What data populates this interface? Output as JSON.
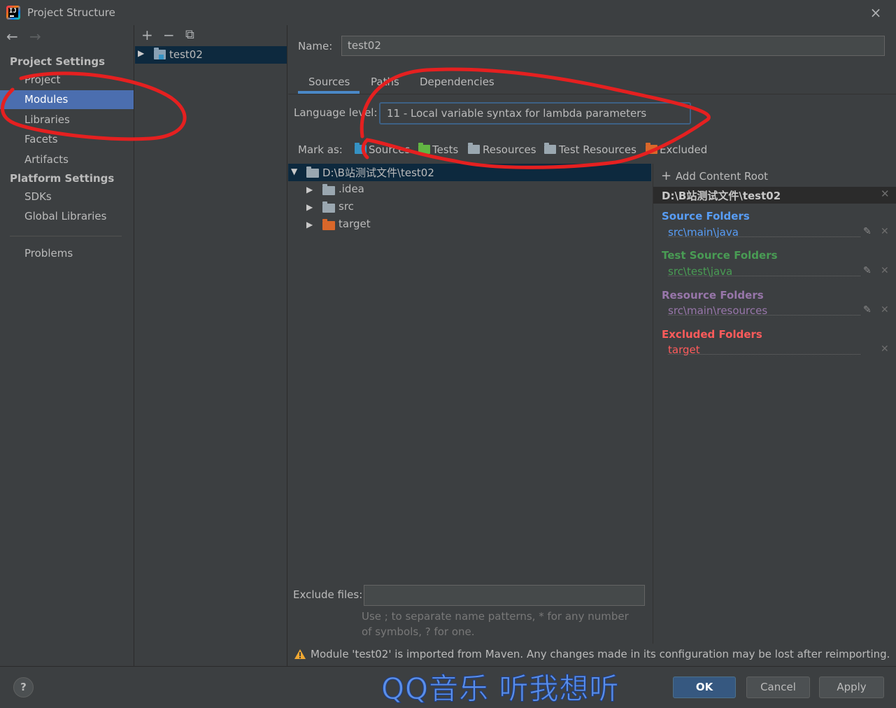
{
  "window": {
    "title": "Project Structure",
    "close_icon": "×"
  },
  "nav": {
    "back_icon": "←",
    "forward_icon": "→",
    "project_settings_header": "Project Settings",
    "platform_settings_header": "Platform Settings",
    "items": {
      "project": "Project",
      "modules": "Modules",
      "libraries": "Libraries",
      "facets": "Facets",
      "artifacts": "Artifacts",
      "sdks": "SDKs",
      "global_libraries": "Global Libraries",
      "problems": "Problems"
    },
    "selected": "modules"
  },
  "modules_panel": {
    "add_icon": "+",
    "remove_icon": "−",
    "copy_icon": "⧉",
    "module_name": "test02"
  },
  "main": {
    "name_label": "Name:",
    "name_value": "test02",
    "tabs": {
      "sources": "Sources",
      "paths": "Paths",
      "dependencies": "Dependencies"
    },
    "active_tab": "sources",
    "language_level_label": "Language level:",
    "language_level_value": "11 - Local variable syntax for lambda parameters",
    "mark_as_label": "Mark as:",
    "mark_as": {
      "sources": "Sources",
      "tests": "Tests",
      "resources": "Resources",
      "test_resources": "Test Resources",
      "excluded": "Excluded"
    },
    "tree": {
      "root": "D:\\B站测试文件\\test02",
      "children": [
        ".idea",
        "src",
        "target"
      ]
    },
    "exclude_files_label": "Exclude files:",
    "exclude_files_value": "",
    "exclude_hint": "Use ; to separate name patterns, * for any number of symbols, ? for one."
  },
  "content_root": {
    "add_label": "Add Content Root",
    "root_path": "D:\\B站测试文件\\test02",
    "source_folders_title": "Source Folders",
    "source_folder_path": "src\\main\\java",
    "test_source_folders_title": "Test Source Folders",
    "test_source_folder_path": "src\\test\\java",
    "resource_folders_title": "Resource Folders",
    "resource_folder_path": "src\\main\\resources",
    "excluded_folders_title": "Excluded Folders",
    "excluded_folder_path": "target",
    "colors": {
      "source": "#589df6",
      "test": "#499c54",
      "resource": "#9876aa",
      "excluded": "#ff5b5b"
    }
  },
  "warning": {
    "text": "Module 'test02' is imported from Maven. Any changes made in its configuration may be lost after reimporting."
  },
  "footer": {
    "help_label": "?",
    "ok_label": "OK",
    "cancel_label": "Cancel",
    "apply_label": "Apply"
  },
  "watermark": "QQ音乐 听我想听"
}
